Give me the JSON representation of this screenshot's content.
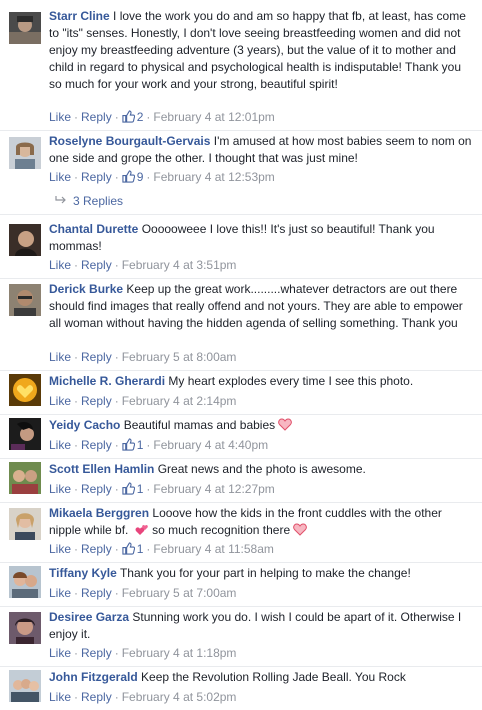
{
  "actions": {
    "like": "Like",
    "reply": "Reply",
    "sep": "·"
  },
  "comments": [
    {
      "author": "Starr Cline",
      "text": "I love the work you do and am so happy that fb, at least, has come to \"its\" senses. Honestly, I don't love seeing breastfeeding women and did not enjoy my breastfeeding adventure (3 years), but the value of it to mother and child in regard to physical and psychological health is indisputable! Thank you so much for your work and your strong, beautiful spirit!",
      "likes": "2",
      "time": "February 4 at 12:01pm"
    },
    {
      "author": "Roselyne Bourgault-Gervais",
      "text": "I'm amused at how most babies seem to nom on one side and grope the other. I thought that was just mine!",
      "likes": "9",
      "time": "February 4 at 12:53pm",
      "replies": "3 Replies"
    },
    {
      "author": "Chantal Durette",
      "text": "Oooooweee I love this!! It's just so beautiful! Thank you mommas!",
      "time": "February 4 at 3:51pm"
    },
    {
      "author": "Derick Burke",
      "text": "Keep up the great work.........whatever detractors are out there should find images that really offend and not yours. They are able to empower all woman without having the hidden agenda of selling something. Thank you",
      "time": "February 5 at 8:00am"
    },
    {
      "author": "Michelle R. Gherardi",
      "text": "My heart explodes every time I see this photo.",
      "time": "February 4 at 2:14pm"
    },
    {
      "author": "Yeidy Cacho",
      "text": "Beautiful mamas and babies",
      "likes": "1",
      "time": "February 4 at 4:40pm"
    },
    {
      "author": "Scott Ellen Hamlin",
      "text": "Great news and the photo is awesome.",
      "likes": "1",
      "time": "February 4 at 12:27pm"
    },
    {
      "author": "Mikaela Berggren",
      "text": "Looove how the kids in the front cuddles with the other nipple while bf.",
      "text2": "so much recognition there",
      "likes": "1",
      "time": "February 4 at 11:58am"
    },
    {
      "author": "Tiffany Kyle",
      "text": "Thank you for your part in helping to make the change!",
      "time": "February 5 at 7:00am"
    },
    {
      "author": "Desiree Garza",
      "text": "Stunning work you do. I wish I could be apart of it. Otherwise I enjoy it.",
      "time": "February 4 at 1:18pm"
    },
    {
      "author": "John Fitzgerald",
      "text": "Keep the Revolution Rolling Jade Beall. You Rock",
      "time": "February 4 at 5:02pm"
    }
  ]
}
